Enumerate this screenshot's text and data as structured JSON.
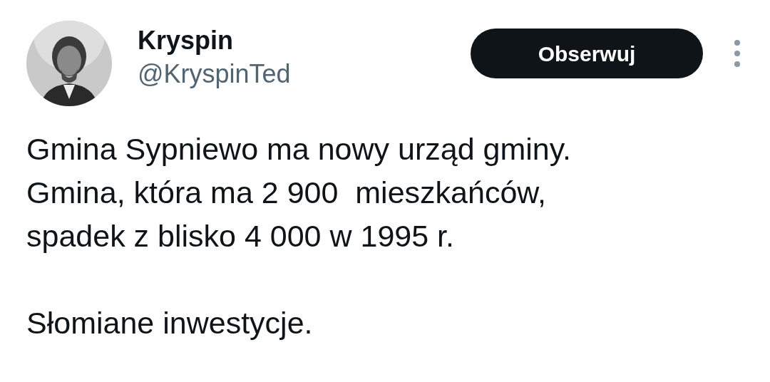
{
  "author": {
    "name": "Kryspin",
    "handle": "@KryspinTed"
  },
  "follow_button": {
    "label": "Obserwuj"
  },
  "tweet": {
    "text": "Gmina Sypniewo ma nowy urząd gminy.\nGmina, która ma 2 900  mieszkańców,\nspadek z blisko 4 000 w 1995 r.\n\nSłomiane inwestycje."
  }
}
